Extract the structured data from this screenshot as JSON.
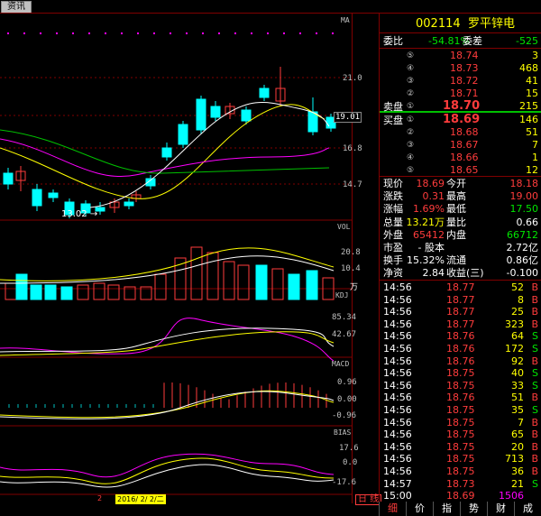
{
  "top_tab": {
    "label": "资讯"
  },
  "chart": {
    "main_indicator": "MA",
    "price_ticks": [
      "21.0",
      "19.01",
      "16.8",
      "14.7"
    ],
    "low_marker": "13.02",
    "vol": {
      "label": "VOL",
      "ticks": [
        "20.8",
        "10.4"
      ],
      "unit": "万"
    },
    "kdj": {
      "label": "KDJ",
      "ticks": [
        "85.34",
        "42.67"
      ]
    },
    "macd": {
      "label": "MACD",
      "ticks": [
        "0.96",
        "0.00",
        "-0.96"
      ]
    },
    "bias": {
      "label": "BIAS",
      "ticks": [
        "17.6",
        "0.0",
        "-17.6"
      ]
    },
    "date_left": "2",
    "date_label": "2016/ 2/ 2/二",
    "corner_label": "日 线",
    "colors": {
      "up": "#ff3c3c",
      "down": "#00ffff",
      "grid": "#800000"
    }
  },
  "quote": {
    "code": "002114",
    "name": "罗平锌电",
    "weibi_label": "委比",
    "weibi_value": "-54.81%",
    "weicha_label": "委差",
    "weicha_value": "-525",
    "sell_label": "卖盘",
    "buy_label": "买盘",
    "asks": [
      {
        "lv": "⑤",
        "price": "18.74",
        "vol": "3"
      },
      {
        "lv": "④",
        "price": "18.73",
        "vol": "468"
      },
      {
        "lv": "③",
        "price": "18.72",
        "vol": "41"
      },
      {
        "lv": "②",
        "price": "18.71",
        "vol": "15"
      },
      {
        "lv": "①",
        "price": "18.70",
        "vol": "215"
      }
    ],
    "bids": [
      {
        "lv": "①",
        "price": "18.69",
        "vol": "146"
      },
      {
        "lv": "②",
        "price": "18.68",
        "vol": "51"
      },
      {
        "lv": "③",
        "price": "18.67",
        "vol": "7"
      },
      {
        "lv": "④",
        "price": "18.66",
        "vol": "1"
      },
      {
        "lv": "⑤",
        "price": "18.65",
        "vol": "12"
      }
    ],
    "stats": [
      {
        "l1": "现价",
        "v1": "18.69",
        "c1": "red",
        "l2": "今开",
        "v2": "18.18",
        "c2": "red"
      },
      {
        "l1": "涨跌",
        "v1": "0.31",
        "c1": "red",
        "l2": "最高",
        "v2": "19.00",
        "c2": "red"
      },
      {
        "l1": "涨幅",
        "v1": "1.69%",
        "c1": "red",
        "l2": "最低",
        "v2": "17.50",
        "c2": "green"
      },
      {
        "l1": "总量",
        "v1": "13.21万",
        "c1": "yel",
        "l2": "量比",
        "v2": "0.66",
        "c2": "white"
      },
      {
        "l1": "外盘",
        "v1": "65412",
        "c1": "red",
        "l2": "内盘",
        "v2": "66712",
        "c2": "green"
      },
      {
        "l1": "市盈",
        "v1": "- 股本",
        "c1": "white",
        "l2": "",
        "v2": "2.72亿",
        "c2": "white"
      },
      {
        "l1": "换手",
        "v1": "15.32%",
        "c1": "white",
        "l2": "流通",
        "v2": "0.86亿",
        "c2": "white"
      },
      {
        "l1": "净资",
        "v1": "2.84",
        "c1": "white",
        "l2": "收益(三)",
        "v2": "-0.100",
        "c2": "white"
      }
    ],
    "ticks": [
      {
        "t": "14:56",
        "p": "18.77",
        "v": "52",
        "s": "B"
      },
      {
        "t": "14:56",
        "p": "18.77",
        "v": "8",
        "s": "B"
      },
      {
        "t": "14:56",
        "p": "18.77",
        "v": "25",
        "s": "B"
      },
      {
        "t": "14:56",
        "p": "18.77",
        "v": "323",
        "s": "B"
      },
      {
        "t": "14:56",
        "p": "18.76",
        "v": "64",
        "s": "S"
      },
      {
        "t": "14:56",
        "p": "18.76",
        "v": "172",
        "s": "S"
      },
      {
        "t": "14:56",
        "p": "18.76",
        "v": "92",
        "s": "B"
      },
      {
        "t": "14:56",
        "p": "18.75",
        "v": "40",
        "s": "S"
      },
      {
        "t": "14:56",
        "p": "18.75",
        "v": "33",
        "s": "S"
      },
      {
        "t": "14:56",
        "p": "18.76",
        "v": "51",
        "s": "B"
      },
      {
        "t": "14:56",
        "p": "18.75",
        "v": "35",
        "s": "S"
      },
      {
        "t": "14:56",
        "p": "18.75",
        "v": "7",
        "s": "B"
      },
      {
        "t": "14:56",
        "p": "18.75",
        "v": "65",
        "s": "B"
      },
      {
        "t": "14:56",
        "p": "18.75",
        "v": "20",
        "s": "B"
      },
      {
        "t": "14:56",
        "p": "18.75",
        "v": "713",
        "s": "B"
      },
      {
        "t": "14:56",
        "p": "18.75",
        "v": "36",
        "s": "B"
      },
      {
        "t": "14:57",
        "p": "18.73",
        "v": "21",
        "s": "S"
      },
      {
        "t": "15:00",
        "p": "18.69",
        "v": "1506",
        "s": ""
      }
    ]
  },
  "bottom_tabs": [
    "细",
    "价",
    "指",
    "势",
    "财",
    "成"
  ]
}
